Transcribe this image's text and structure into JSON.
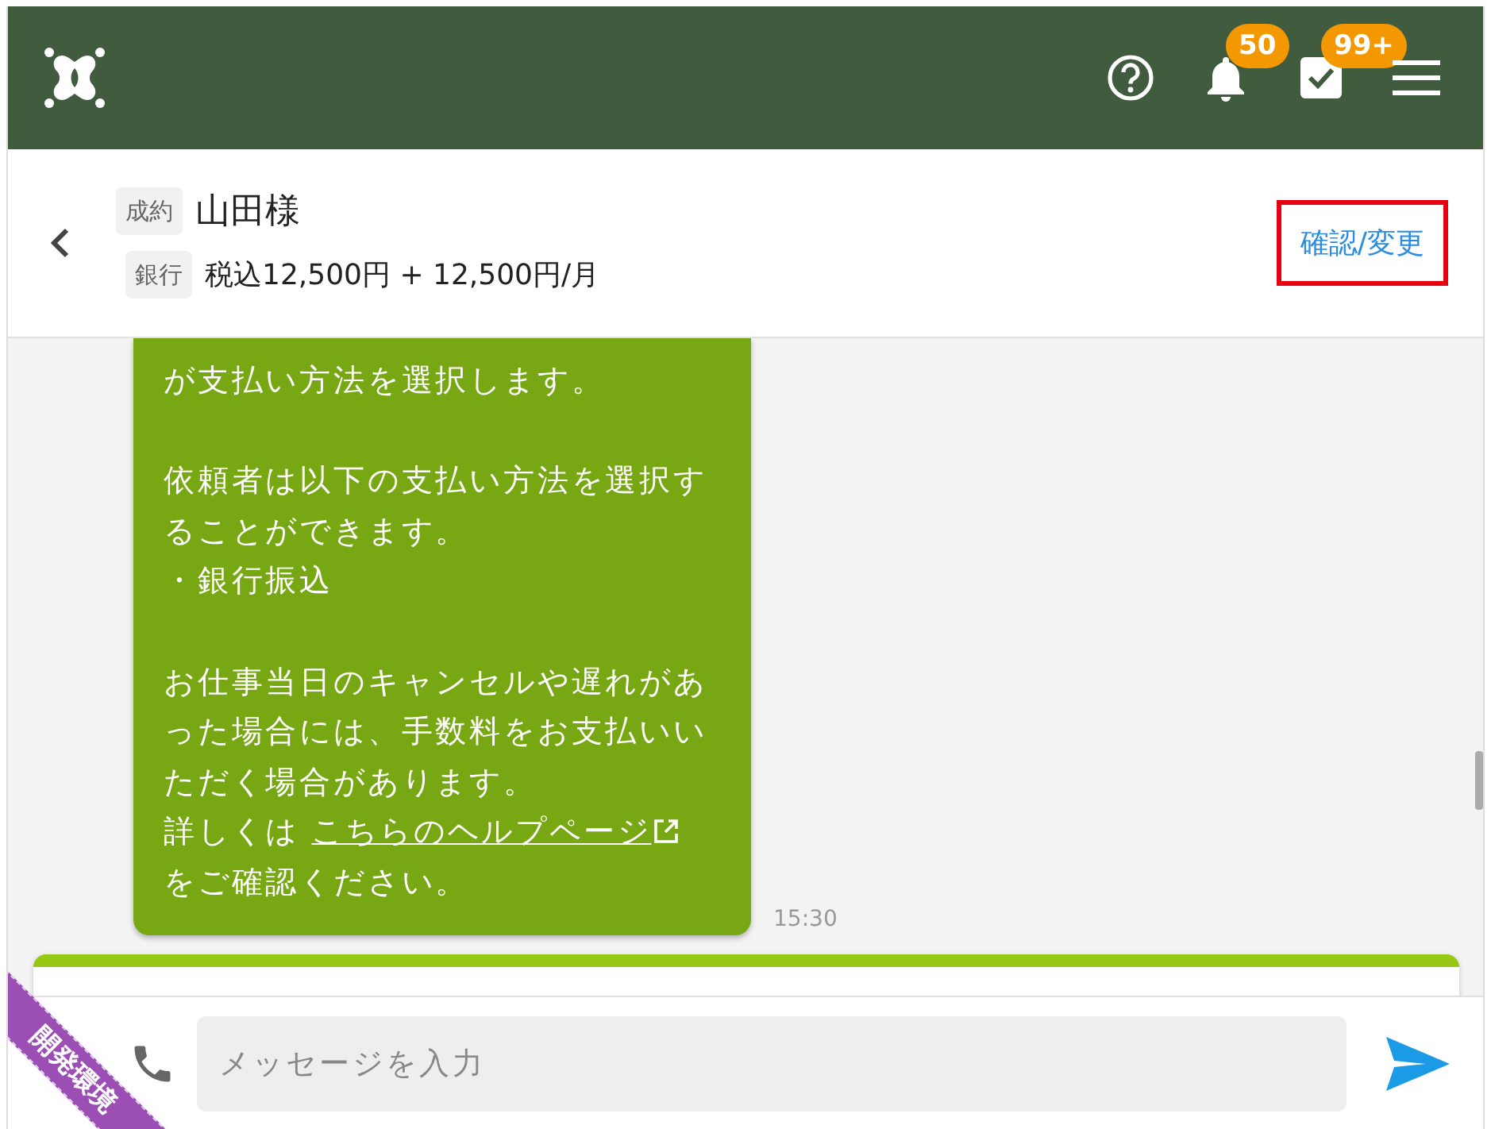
{
  "header": {
    "notifications_badge": "50",
    "tasks_badge": "99+"
  },
  "deal": {
    "status_tag": "成約",
    "customer": "山田様",
    "payment_tag": "銀行",
    "price": "税込12,500円 + 12,500円/月",
    "action": "確認/変更"
  },
  "messages": [
    {
      "kind": "sent",
      "time": "15:30",
      "paragraphs": [
        {
          "lines": [
            {
              "text": "が支払い方法を選択します。"
            }
          ]
        },
        {
          "lines": [
            {
              "text": "依頼者は以下の支払い方法を選択することができます。"
            },
            {
              "text": "・銀行振込"
            }
          ]
        },
        {
          "lines": [
            {
              "text": "お仕事当日のキャンセルや遅れがあった場合には、手数料をお支払いいただく場合があります。"
            },
            {
              "text": "詳しくは ",
              "link": "こちらのヘルプページ",
              "after": " をご確認ください。"
            }
          ]
        }
      ]
    },
    {
      "kind": "card"
    }
  ],
  "composer": {
    "placeholder": "メッセージを入力"
  },
  "environment_ribbon": "開発環境"
}
